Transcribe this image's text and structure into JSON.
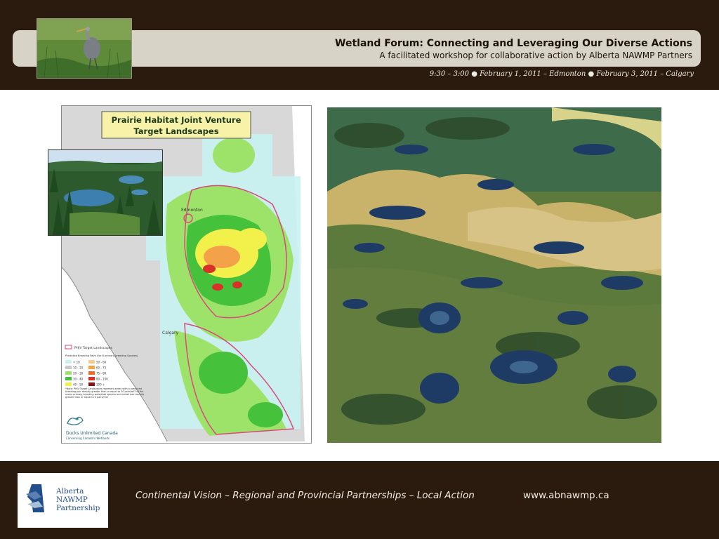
{
  "header": {
    "title": "Wetland Forum: Connecting and Leveraging Our Diverse Actions",
    "subtitle": "A facilitated workshop for collaborative action by Alberta NAWMP Partners",
    "date_line": "9:30 – 3:00 ● February 1, 2011 – Edmonton ● February 3, 2011 – Calgary"
  },
  "map": {
    "title_line1": "Prairie Habitat Joint Venture",
    "title_line2": "Target Landscapes",
    "city_edmonton": "Edmonton",
    "city_calgary": "Calgary",
    "legend_target": "PHJV Target Landscapes",
    "legend_heading": "Predicted Breeding Pairs (for 6 primary breeding Species)",
    "legend_values": [
      "< 10",
      "10 - 20",
      "20 - 30",
      "30 - 40",
      "40 - 50",
      "50 - 60",
      "60 - 75",
      "75 - 80",
      "80 - 100",
      "100 +"
    ],
    "legend_colors": [
      "#c8f2f2",
      "#c9c9c9",
      "#9de36a",
      "#45c13c",
      "#f2f04a",
      "#f7c995",
      "#f4a24a",
      "#ee6a2b",
      "#d9302a",
      "#8c1010"
    ],
    "note": "*Note: PHJV Target Landscapes represent areas with a predicted breeding pair density greater than or equal to 30 pairs/mi2 of the seven primary breeding waterfowl species and pintail pair density greater than or equal to 5 pairs/mi2",
    "org_name": "Ducks Unlimited Canada",
    "org_tagline": "Conserving Canada's Wetlands"
  },
  "footer": {
    "logo_line1": "Alberta",
    "logo_line2": "NAWMP",
    "logo_line3": "Partnership",
    "motto": "Continental Vision – Regional and Provincial Partnerships – Local Action",
    "url": "www.abnawmp.ca"
  },
  "colors": {
    "band": "#2b1a0e",
    "title_bar": "#d7d3c6",
    "heat_low": "#9de36a",
    "heat_mid": "#45c13c",
    "heat_high": "#f2f04a",
    "heat_peak": "#d9302a",
    "target_outline": "#d94a7a"
  }
}
